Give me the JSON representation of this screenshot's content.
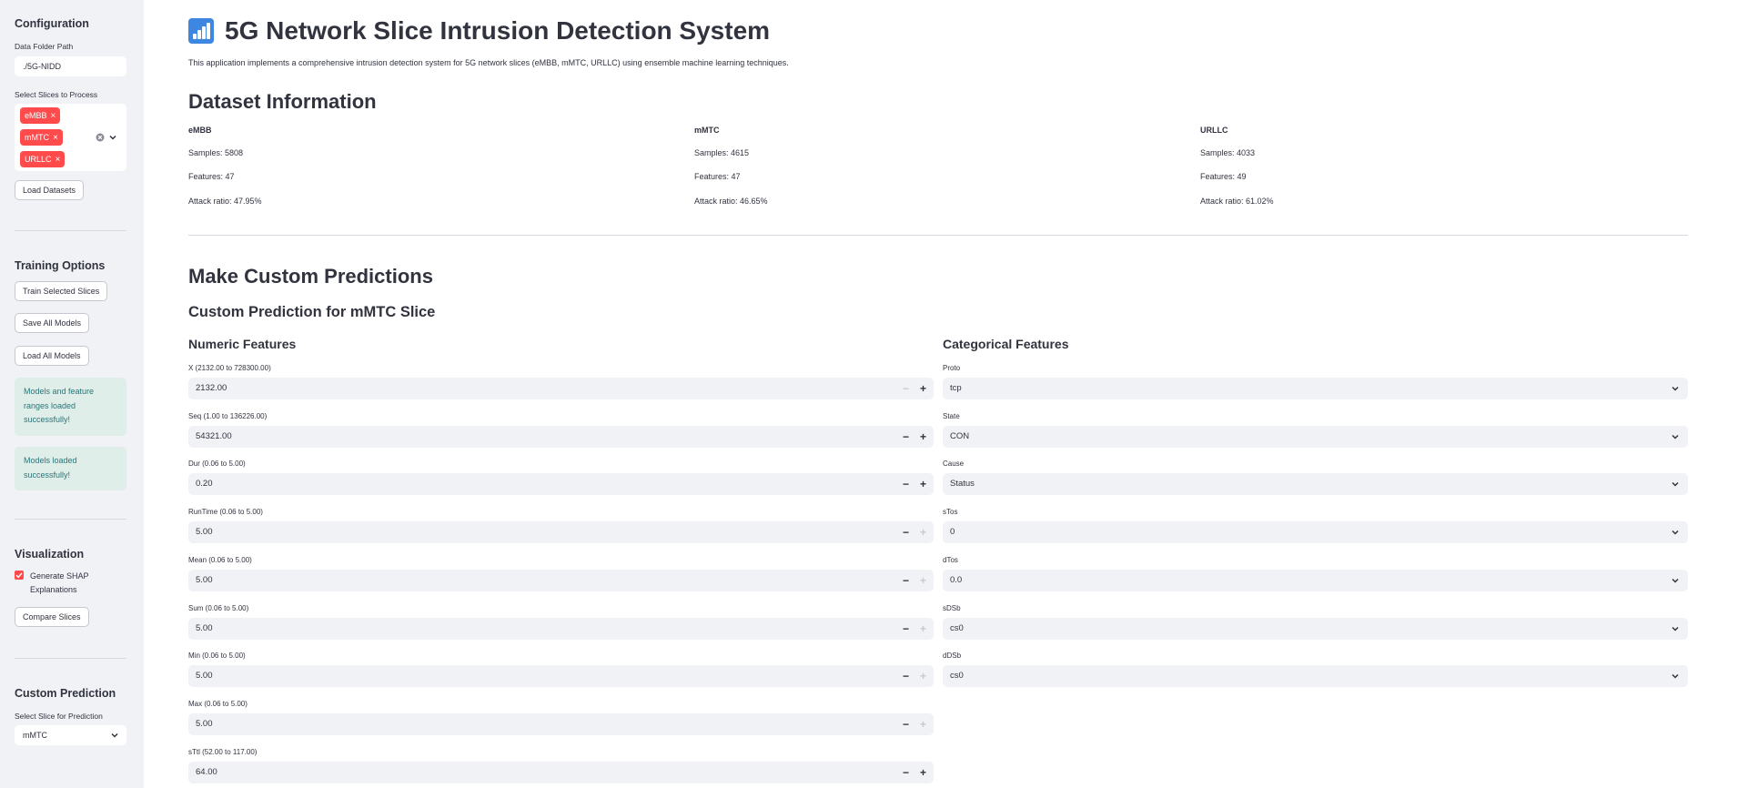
{
  "sidebar": {
    "config_heading": "Configuration",
    "data_folder_label": "Data Folder Path",
    "data_folder_value": "./5G-NIDD",
    "slices_label": "Select Slices to Process",
    "slice_tags": [
      "eMBB",
      "mMTC",
      "URLLC"
    ],
    "load_datasets": "Load Datasets",
    "training_heading": "Training Options",
    "train_selected": "Train Selected Slices",
    "save_all": "Save All Models",
    "load_all": "Load All Models",
    "alert1": "Models and feature ranges loaded successfully!",
    "alert2": "Models loaded successfully!",
    "viz_heading": "Visualization",
    "shap_label": "Generate SHAP Explanations",
    "shap_checked": true,
    "compare_slices": "Compare Slices",
    "custom_heading": "Custom Prediction",
    "select_slice_label": "Select Slice for Prediction",
    "select_slice_value": "mMTC"
  },
  "main": {
    "title": "5G Network Slice Intrusion Detection System",
    "intro": "This application implements a comprehensive intrusion detection system for 5G network slices (eMBB, mMTC, URLLC) using ensemble machine learning techniques.",
    "dataset_heading": "Dataset Information",
    "datasets": [
      {
        "name": "eMBB",
        "samples": "Samples: 5808",
        "features": "Features: 47",
        "attack": "Attack ratio: 47.95%"
      },
      {
        "name": "mMTC",
        "samples": "Samples: 4615",
        "features": "Features: 47",
        "attack": "Attack ratio: 46.65%"
      },
      {
        "name": "URLLC",
        "samples": "Samples: 4033",
        "features": "Features: 49",
        "attack": "Attack ratio: 61.02%"
      }
    ],
    "predictions_heading": "Make Custom Predictions",
    "custom_slice_heading": "Custom Prediction for mMTC Slice",
    "numeric_heading": "Numeric Features",
    "categorical_heading": "Categorical Features",
    "numeric_fields": [
      {
        "label": "X (2132.00 to 728300.00)",
        "value": "2132.00",
        "minus_disabled": true,
        "plus_disabled": false
      },
      {
        "label": "Seq (1.00 to 136226.00)",
        "value": "54321.00",
        "minus_disabled": false,
        "plus_disabled": false
      },
      {
        "label": "Dur (0.06 to 5.00)",
        "value": "0.20",
        "minus_disabled": false,
        "plus_disabled": false
      },
      {
        "label": "RunTime (0.06 to 5.00)",
        "value": "5.00",
        "minus_disabled": false,
        "plus_disabled": true
      },
      {
        "label": "Mean (0.06 to 5.00)",
        "value": "5.00",
        "minus_disabled": false,
        "plus_disabled": true
      },
      {
        "label": "Sum (0.06 to 5.00)",
        "value": "5.00",
        "minus_disabled": false,
        "plus_disabled": true
      },
      {
        "label": "Min (0.06 to 5.00)",
        "value": "5.00",
        "minus_disabled": false,
        "plus_disabled": true
      },
      {
        "label": "Max (0.06 to 5.00)",
        "value": "5.00",
        "minus_disabled": false,
        "plus_disabled": true
      },
      {
        "label": "sTtl (52.00 to 117.00)",
        "value": "64.00",
        "minus_disabled": false,
        "plus_disabled": false
      }
    ],
    "categorical_fields": [
      {
        "label": "Proto",
        "value": "tcp"
      },
      {
        "label": "State",
        "value": "CON"
      },
      {
        "label": "Cause",
        "value": "Status"
      },
      {
        "label": "sTos",
        "value": "0"
      },
      {
        "label": "dTos",
        "value": "0.0"
      },
      {
        "label": "sDSb",
        "value": "cs0"
      },
      {
        "label": "dDSb",
        "value": "cs0"
      }
    ]
  },
  "colors": {
    "accent": "#ff4b4b",
    "sidebar_bg": "#f0f2f6",
    "success_bg": "#dfeee8",
    "success_text": "#29757a"
  }
}
